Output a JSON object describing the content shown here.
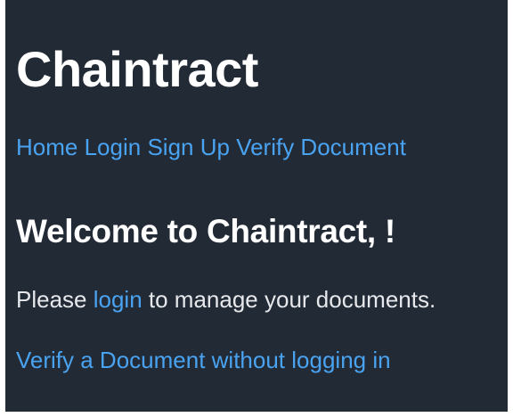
{
  "app": {
    "title": "Chaintract"
  },
  "nav": {
    "home": "Home",
    "login": "Login",
    "signup": "Sign Up",
    "verify": "Verify Document"
  },
  "main": {
    "welcome": "Welcome to Chaintract, !",
    "prompt_before": "Please ",
    "prompt_link": "login",
    "prompt_after": " to manage your documents.",
    "verify_link": "Verify a Document without logging in"
  },
  "colors": {
    "background": "#222a36",
    "link": "#4aa3f0",
    "heading": "#ffffff",
    "body_text": "#e6e8eb"
  }
}
